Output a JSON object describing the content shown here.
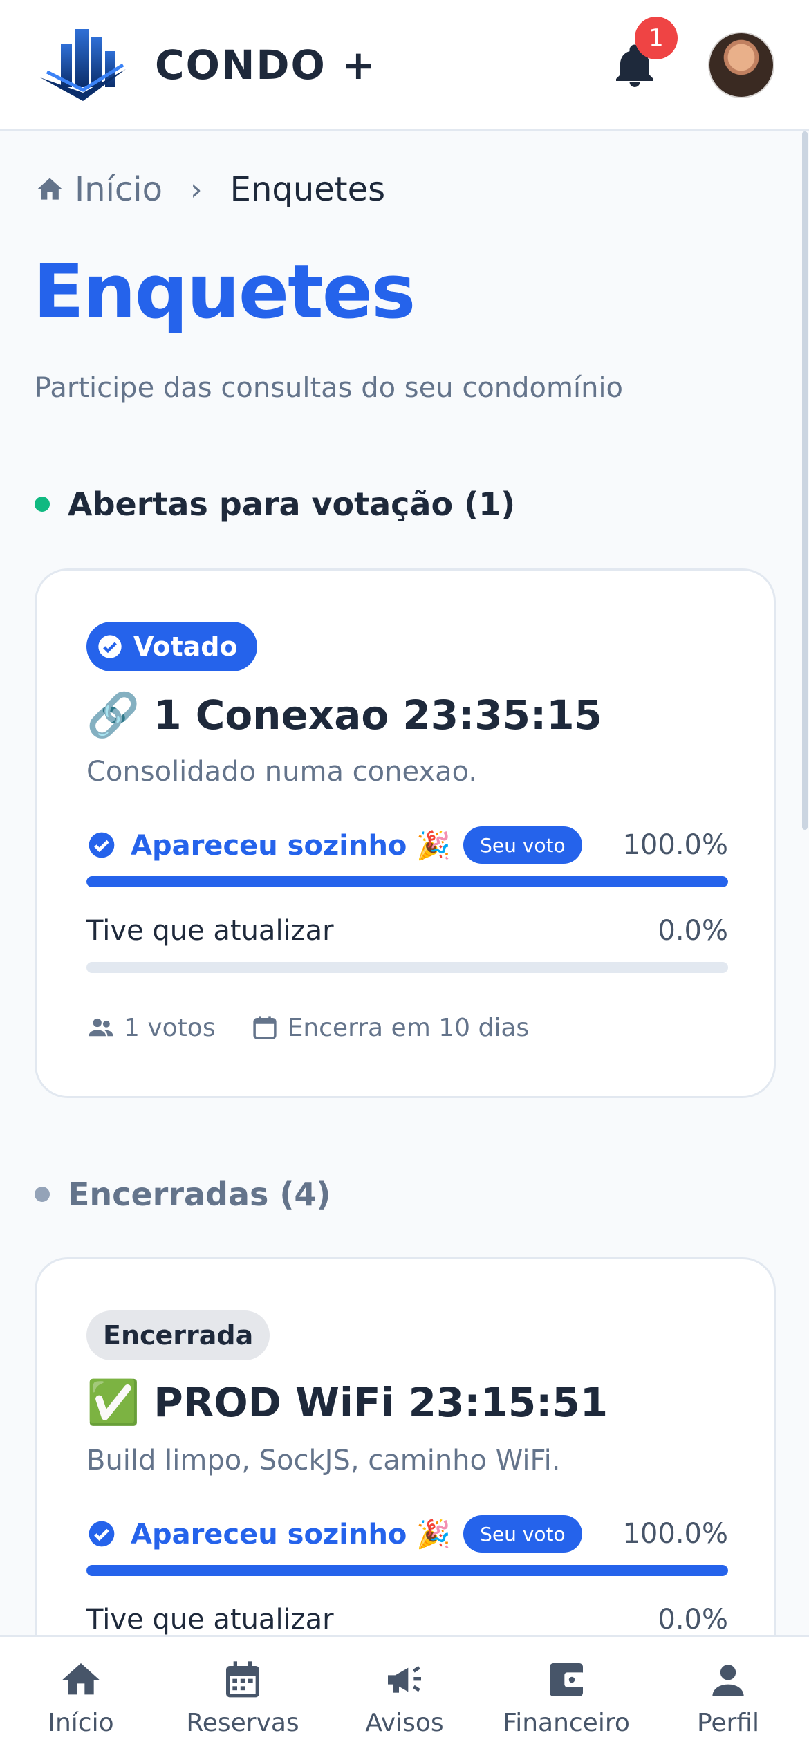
{
  "header": {
    "brand": "CONDO +",
    "notification_count": "1",
    "logo_icon": "building-logo-icon",
    "bell_icon": "bell-icon"
  },
  "breadcrumb": {
    "home": "Início",
    "separator": "›",
    "current": "Enquetes"
  },
  "page": {
    "title": "Enquetes",
    "subtitle": "Participe das consultas do seu condomínio"
  },
  "colors": {
    "accent": "#2563eb",
    "open_dot": "#10b981",
    "closed_dot": "#94a3b8",
    "badge": "#ef4444"
  },
  "open_section": {
    "heading": "Abertas para votação (1)",
    "poll": {
      "badge": "Votado",
      "emoji": "🔗",
      "title": "1 Conexao 23:35:15",
      "description": "Consolidado numa conexao.",
      "options": [
        {
          "label": "Apareceu sozinho 🎉",
          "tag": "Seu voto",
          "pct": "100.0%",
          "fraction": 1.0
        },
        {
          "label": "Tive que atualizar",
          "pct": "0.0%",
          "fraction": 0.0
        }
      ],
      "votes": "1 votos",
      "ends": "Encerra em 10 dias"
    }
  },
  "closed_section": {
    "heading": "Encerradas (4)",
    "poll": {
      "badge": "Encerrada",
      "emoji": "✅",
      "title": "PROD WiFi 23:15:51",
      "description": "Build limpo, SockJS, caminho WiFi.",
      "options": [
        {
          "label": "Apareceu sozinho 🎉",
          "tag": "Seu voto",
          "pct": "100.0%",
          "fraction": 1.0
        },
        {
          "label": "Tive que atualizar",
          "pct": "0.0%",
          "fraction": 0.0
        }
      ]
    }
  },
  "bottom_nav": [
    {
      "label": "Início",
      "icon": "home-icon"
    },
    {
      "label": "Reservas",
      "icon": "calendar-icon"
    },
    {
      "label": "Avisos",
      "icon": "megaphone-icon"
    },
    {
      "label": "Financeiro",
      "icon": "wallet-icon"
    },
    {
      "label": "Perfil",
      "icon": "person-icon"
    }
  ]
}
